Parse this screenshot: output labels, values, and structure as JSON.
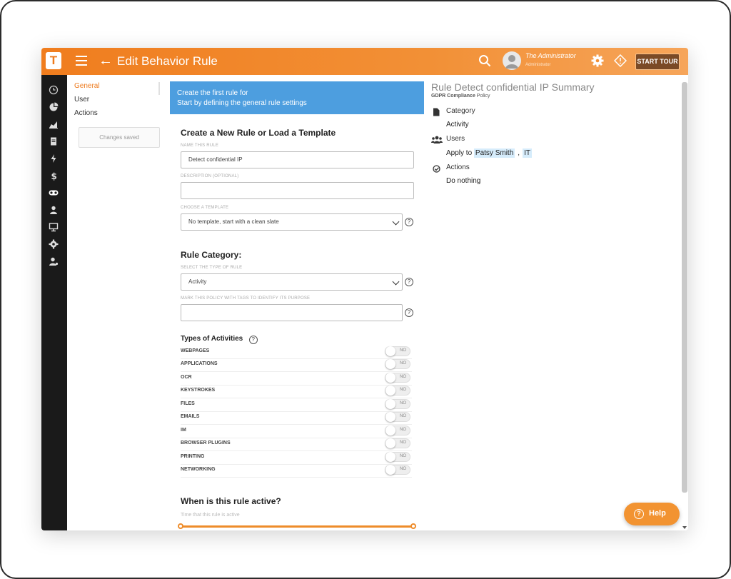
{
  "app": {
    "logo": "T",
    "page_title": "Edit Behavior Rule",
    "user_name": "The Administrator",
    "user_role": "Administrator",
    "start_tour_label": "START TOUR",
    "brand_color": "#ee7a1c"
  },
  "steps": {
    "items": [
      {
        "label": "General",
        "active": true
      },
      {
        "label": "User",
        "active": false
      },
      {
        "label": "Actions",
        "active": false
      }
    ],
    "saved_status": "Changes saved"
  },
  "banner": {
    "line1": "Create the first rule for",
    "line2": "Start by defining the general rule settings"
  },
  "form": {
    "heading": "Create a New Rule or Load a Template",
    "name_label": "NAME THIS RULE",
    "name_value": "Detect confidential IP",
    "description_label": "DESCRIPTION (OPTIONAL)",
    "description_value": "",
    "template_label": "CHOOSE A TEMPLATE",
    "template_value": "No template, start with a clean slate",
    "category_heading": "Rule Category:",
    "type_label": "SELECT THE TYPE OF RULE",
    "type_value": "Activity",
    "tags_label": "MARK THIS POLICY WITH TAGS TO IDENTIFY ITS PURPOSE",
    "tags_value": "",
    "activities_heading": "Types of Activities",
    "activities": [
      {
        "label": "WEBPAGES",
        "state": "NO"
      },
      {
        "label": "APPLICATIONS",
        "state": "NO"
      },
      {
        "label": "OCR",
        "state": "NO"
      },
      {
        "label": "KEYSTROKES",
        "state": "NO"
      },
      {
        "label": "FILES",
        "state": "NO"
      },
      {
        "label": "EMAILS",
        "state": "NO"
      },
      {
        "label": "IM",
        "state": "NO"
      },
      {
        "label": "BROWSER PLUGINS",
        "state": "NO"
      },
      {
        "label": "PRINTING",
        "state": "NO"
      },
      {
        "label": "NETWORKING",
        "state": "NO"
      }
    ],
    "active_heading": "When is this rule active?",
    "active_sub": "Time that this rule is active"
  },
  "summary": {
    "title": "Rule Detect confidential IP Summary",
    "policy_bold": "GDPR Compliance",
    "policy_rest": " Policy",
    "category_label": "Category",
    "category_value": "Activity",
    "users_label": "Users",
    "users_prefix": "Apply to",
    "user_chip_1": "Patsy Smith",
    "user_sep": ",",
    "user_chip_2": "IT",
    "actions_label": "Actions",
    "actions_value": "Do nothing"
  },
  "help": {
    "label": "Help"
  }
}
